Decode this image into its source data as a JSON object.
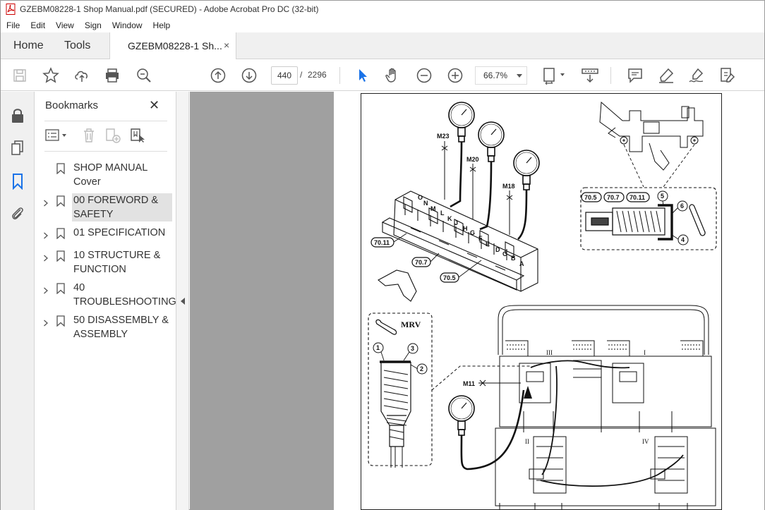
{
  "window": {
    "title": "GZEBM08228-1 Shop Manual.pdf (SECURED) - Adobe Acrobat Pro DC (32-bit)"
  },
  "menu": [
    "File",
    "Edit",
    "View",
    "Sign",
    "Window",
    "Help"
  ],
  "tabs": {
    "home": "Home",
    "tools": "Tools",
    "document": "GZEBM08228-1 Sh...",
    "close": "×"
  },
  "toolbar": {
    "icons": [
      "save-icon",
      "bookmark-star-icon",
      "upload-icon",
      "print-icon",
      "zoom-search-icon",
      "page-up-icon",
      "page-down-icon",
      "select-arrow-icon",
      "hand-icon",
      "zoom-out-icon",
      "zoom-in-icon",
      "page-fit-icon",
      "scroll-mode-icon",
      "comment-icon",
      "highlight-icon",
      "sign-icon",
      "edit-pdf-icon"
    ],
    "page_current": "440",
    "page_separator": "/",
    "page_total": "2296",
    "zoom": "66.7%"
  },
  "bookmarks": {
    "title": "Bookmarks",
    "close": "✕",
    "items": [
      {
        "label": "SHOP MANUAL Cover",
        "expandable": false,
        "selected": false
      },
      {
        "label": "00 FOREWORD & SAFETY",
        "expandable": true,
        "selected": true
      },
      {
        "label": "01 SPECIFICATION",
        "expandable": true,
        "selected": false
      },
      {
        "label": "10 STRUCTURE & FUNCTION",
        "expandable": true,
        "selected": false
      },
      {
        "label": "40 TROUBLESHOOTING",
        "expandable": true,
        "selected": false
      },
      {
        "label": "50 DISASSEMBLY & ASSEMBLY",
        "expandable": true,
        "selected": false
      }
    ]
  },
  "document": {
    "labels": {
      "m23": "M23",
      "m20": "M20",
      "m18": "M18",
      "m11": "M11",
      "c7011a": "70.11",
      "c707a": "70.7",
      "c705a": "70.5",
      "c705b": "70.5",
      "c707b": "70.7",
      "c7011b": "70.11",
      "n5": "5",
      "n6": "6",
      "n4": "4",
      "mrv": "MRV",
      "n1": "1",
      "n2": "2",
      "n3": "3",
      "r3": "III",
      "r1": "I",
      "r2": "II",
      "r4": "IV",
      "lO": "O",
      "lN": "N",
      "lM": "M",
      "lL": "L",
      "lK": "K",
      "lJ": "J",
      "lH": "H",
      "lG": "G",
      "lF": "F",
      "lE": "E",
      "lD": "D",
      "lC": "C",
      "lB": "B",
      "lA": "A"
    }
  },
  "colors": {
    "accent": "#1a73e8",
    "chrome": "#f0f0f0",
    "viewer_gray": "#a0a0a0"
  }
}
